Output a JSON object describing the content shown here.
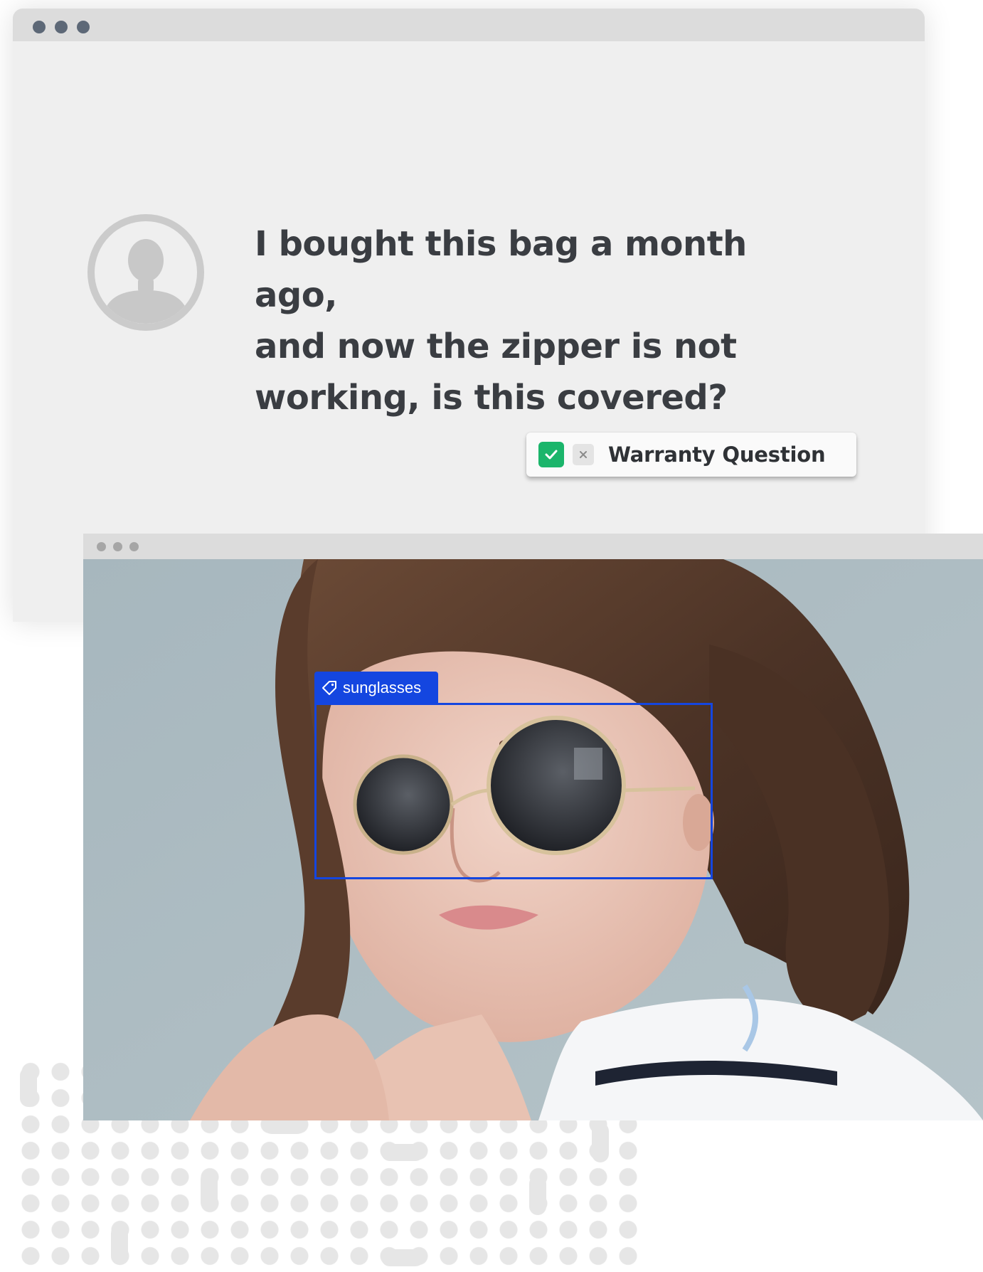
{
  "message_window": {
    "message_text": "I bought this bag a month ago, and now the zipper is not working, is this covered?",
    "message_lines": [
      "I bought this bag a month ago,",
      "and now the zipper is not",
      "working, is this covered?"
    ],
    "tag": {
      "label": "Warranty Question",
      "checked": true,
      "check_color": "#1bb56b"
    }
  },
  "image_window": {
    "annotation": {
      "label": "sunglasses",
      "color": "#1446e0"
    }
  },
  "icons": {
    "user": "user-avatar-icon",
    "check": "check-icon",
    "remove": "close-icon",
    "tag": "tag-icon"
  }
}
